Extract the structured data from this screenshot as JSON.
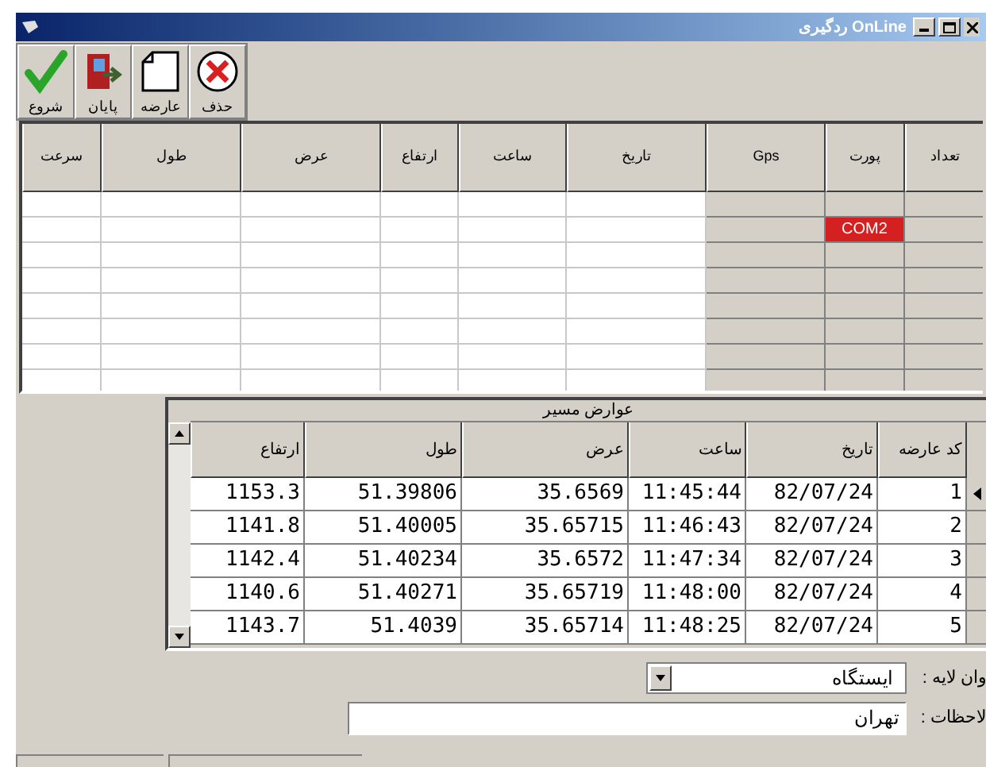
{
  "window": {
    "title": "ردگیری OnLine"
  },
  "toolbar": [
    {
      "kind": "delete",
      "label": "حذف"
    },
    {
      "kind": "feature",
      "label": "عارضه"
    },
    {
      "kind": "exit",
      "label": "پایان"
    },
    {
      "kind": "start",
      "label": "شروع"
    }
  ],
  "gps_grid": {
    "columns": [
      "تعداد",
      "پورت",
      "Gps",
      "تاریخ",
      "ساعت",
      "ارتفاع",
      "عرض",
      "طول",
      "سرعت"
    ],
    "port_value": "COM2"
  },
  "features_grid": {
    "title": "عوارض مسیر",
    "columns": [
      "کد عارضه",
      "تاریخ",
      "ساعت",
      "عرض",
      "طول",
      "ارتفاع"
    ],
    "rows": [
      {
        "selected": true,
        "cells": [
          "1",
          "82/07/24",
          "11:45:44",
          "35.6569",
          "51.39806",
          "1153.3"
        ]
      },
      {
        "selected": false,
        "cells": [
          "2",
          "82/07/24",
          "11:46:43",
          "35.65715",
          "51.40005",
          "1141.8"
        ]
      },
      {
        "selected": false,
        "cells": [
          "3",
          "82/07/24",
          "11:47:34",
          "35.6572",
          "51.40234",
          "1142.4"
        ]
      },
      {
        "selected": false,
        "cells": [
          "4",
          "82/07/24",
          "11:48:00",
          "35.65719",
          "51.40271",
          "1140.6"
        ]
      },
      {
        "selected": false,
        "cells": [
          "5",
          "82/07/24",
          "11:48:25",
          "35.65714",
          "51.4039",
          "1143.7"
        ]
      }
    ]
  },
  "layer": {
    "label": "وان لایه :",
    "value": "ایستگاه"
  },
  "notes": {
    "label": "لاحظات :",
    "value": "تهران"
  }
}
